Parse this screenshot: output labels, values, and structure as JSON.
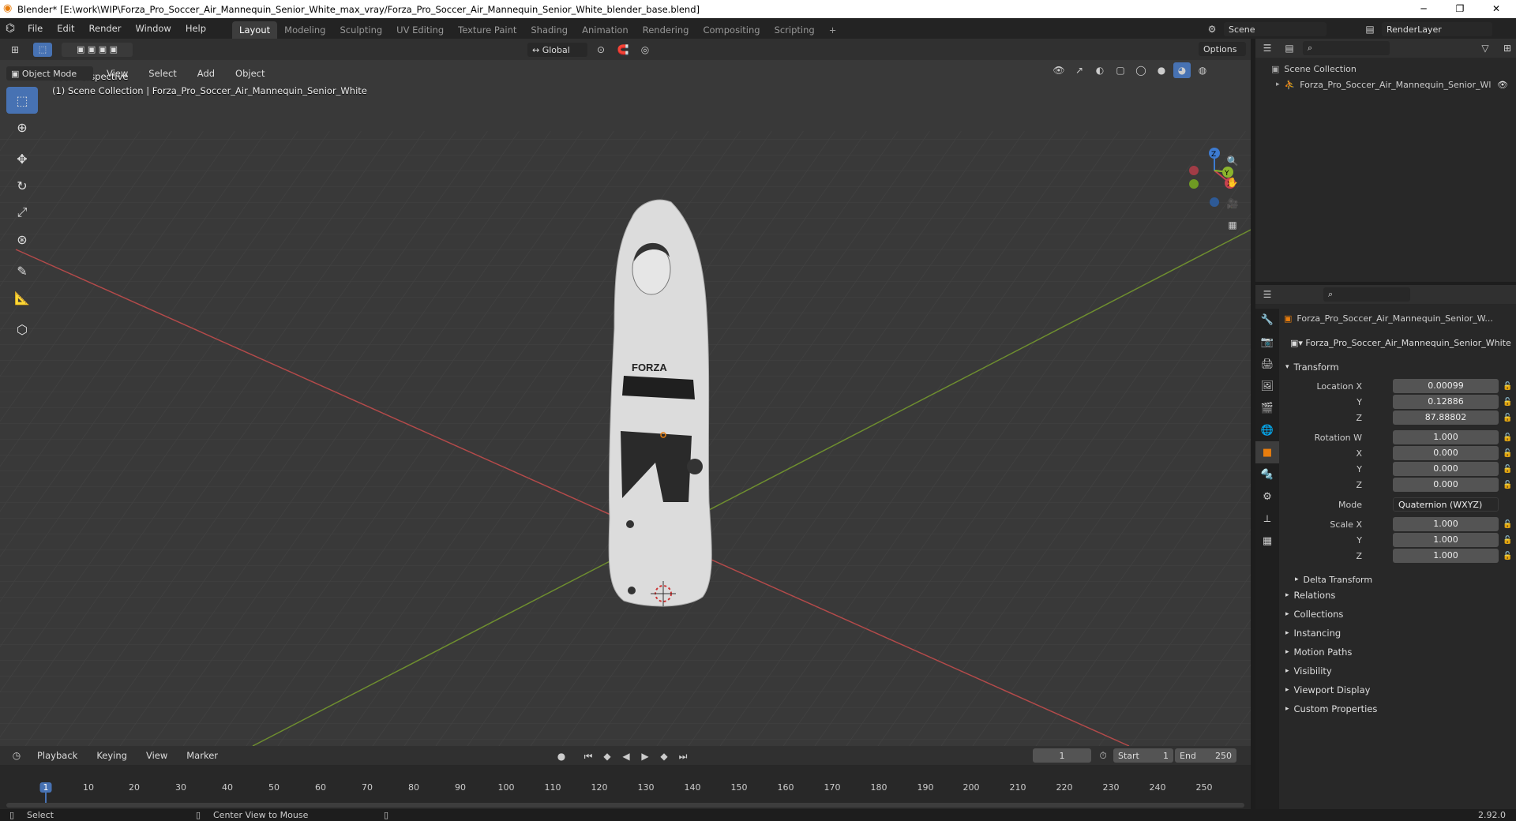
{
  "app": {
    "title": "Blender* [E:\\work\\WIP\\Forza_Pro_Soccer_Air_Mannequin_Senior_White_max_vray/Forza_Pro_Soccer_Air_Mannequin_Senior_White_blender_base.blend]",
    "version": "2.92.0"
  },
  "menu": [
    "File",
    "Edit",
    "Render",
    "Window",
    "Help"
  ],
  "workspaces": [
    "Layout",
    "Modeling",
    "Sculpting",
    "UV Editing",
    "Texture Paint",
    "Shading",
    "Animation",
    "Rendering",
    "Compositing",
    "Scripting"
  ],
  "top": {
    "scene": "Scene",
    "render_layer": "RenderLayer",
    "options": "Options",
    "transform_orientation": "Global"
  },
  "viewport": {
    "mode": "Object Mode",
    "menus": [
      "View",
      "Select",
      "Add",
      "Object"
    ],
    "perspective": "User Perspective",
    "collection_line": "(1) Scene Collection | Forza_Pro_Soccer_Air_Mannequin_Senior_White",
    "model_text": "FORZA",
    "axes": {
      "x": "X",
      "y": "Y",
      "z": "Z"
    }
  },
  "outliner": {
    "root": "Scene Collection",
    "item": "Forza_Pro_Soccer_Air_Mannequin_Senior_Wl"
  },
  "properties": {
    "object_name": "Forza_Pro_Soccer_Air_Mannequin_Senior_W...",
    "object_field": "Forza_Pro_Soccer_Air_Mannequin_Senior_White",
    "transform_label": "Transform",
    "location": {
      "label_x": "Location X",
      "label_y": "Y",
      "label_z": "Z",
      "x": "0.00099",
      "y": "0.12886",
      "z": "87.88802"
    },
    "rotation": {
      "label_w": "Rotation W",
      "label_x": "X",
      "label_y": "Y",
      "label_z": "Z",
      "w": "1.000",
      "x": "0.000",
      "y": "0.000",
      "z": "0.000"
    },
    "mode_label": "Mode",
    "mode": "Quaternion (WXYZ)",
    "scale": {
      "label_x": "Scale X",
      "label_y": "Y",
      "label_z": "Z",
      "x": "1.000",
      "y": "1.000",
      "z": "1.000"
    },
    "delta": "Delta Transform",
    "sections": [
      "Relations",
      "Collections",
      "Instancing",
      "Motion Paths",
      "Visibility",
      "Viewport Display",
      "Custom Properties"
    ]
  },
  "timeline": {
    "menus": [
      "Playback",
      "Keying",
      "View",
      "Marker"
    ],
    "current_frame": "1",
    "start_label": "Start",
    "start": "1",
    "end_label": "End",
    "end": "250",
    "ticks": [
      "1",
      "10",
      "20",
      "30",
      "40",
      "50",
      "60",
      "70",
      "80",
      "90",
      "100",
      "110",
      "120",
      "130",
      "140",
      "150",
      "160",
      "170",
      "180",
      "190",
      "200",
      "210",
      "220",
      "230",
      "240",
      "250"
    ]
  },
  "status": {
    "select": "Select",
    "center": "Center View to Mouse"
  },
  "colors": {
    "accent": "#4772b3",
    "x_axis": "#b34a4a",
    "y_axis": "#6e8e2f"
  }
}
